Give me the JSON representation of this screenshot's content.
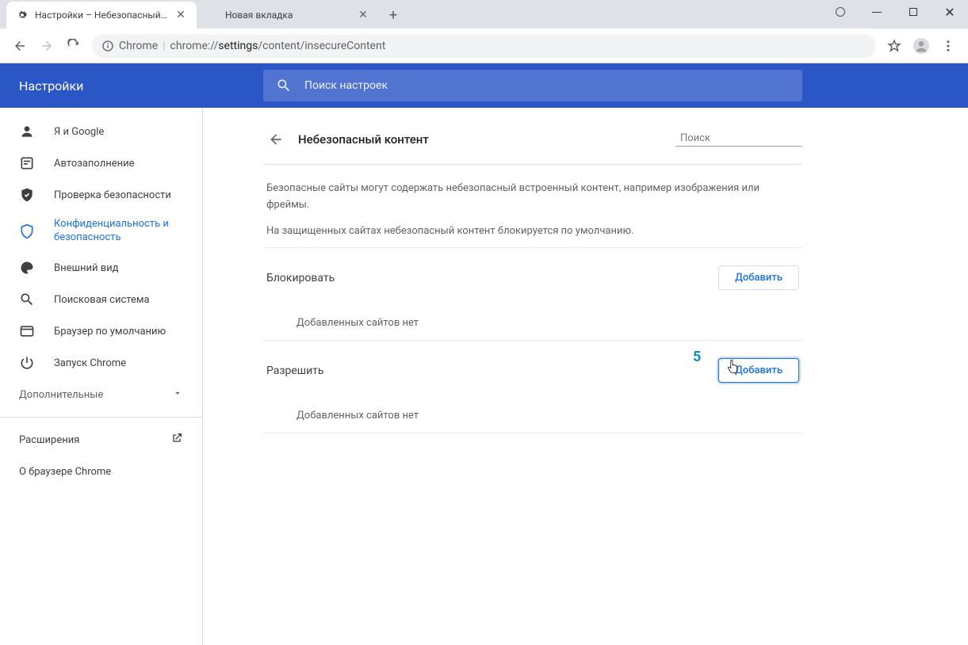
{
  "window": {
    "tabs": [
      {
        "title": "Настройки – Небезопасный кон",
        "active": true
      },
      {
        "title": "Новая вкладка",
        "active": false
      }
    ]
  },
  "addressbar": {
    "prefix": "Chrome",
    "url_grey1": "chrome://",
    "url_dark": "settings",
    "url_grey2": "/content/insecureContent"
  },
  "header": {
    "title": "Настройки",
    "search_placeholder": "Поиск настроек"
  },
  "sidebar": {
    "items": [
      {
        "label": "Я и Google"
      },
      {
        "label": "Автозаполнение"
      },
      {
        "label": "Проверка безопасности"
      },
      {
        "label": "Конфиденциальность и безопасность"
      },
      {
        "label": "Внешний вид"
      },
      {
        "label": "Поисковая система"
      },
      {
        "label": "Браузер по умолчанию"
      },
      {
        "label": "Запуск Chrome"
      }
    ],
    "advanced_label": "Дополнительные",
    "footer": {
      "extensions": "Расширения",
      "about": "О браузере Chrome"
    }
  },
  "panel": {
    "title": "Небезопасный контент",
    "search_placeholder": "Поиск",
    "description1": "Безопасные сайты могут содержать небезопасный встроенный контент, например изображения или фреймы.",
    "description2": "На защищенных сайтах небезопасный контент блокируется по умолчанию.",
    "block": {
      "title": "Блокировать",
      "add": "Добавить",
      "empty": "Добавленных сайтов нет"
    },
    "allow": {
      "title": "Разрешить",
      "add": "Добавить",
      "empty": "Добавленных сайтов нет"
    }
  },
  "annotation": {
    "step": "5"
  }
}
